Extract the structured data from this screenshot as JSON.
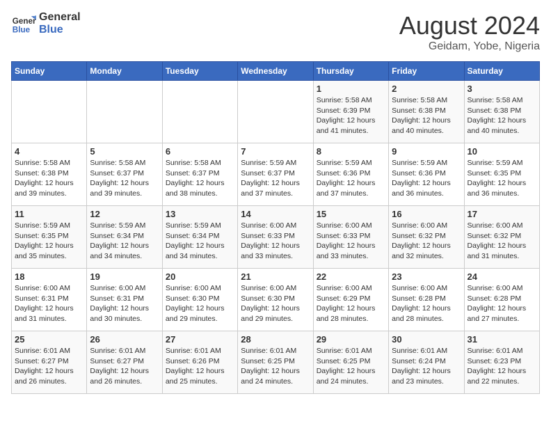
{
  "logo": {
    "general": "General",
    "blue": "Blue"
  },
  "title": "August 2024",
  "subtitle": "Geidam, Yobe, Nigeria",
  "days_of_week": [
    "Sunday",
    "Monday",
    "Tuesday",
    "Wednesday",
    "Thursday",
    "Friday",
    "Saturday"
  ],
  "weeks": [
    [
      {
        "day": "",
        "info": ""
      },
      {
        "day": "",
        "info": ""
      },
      {
        "day": "",
        "info": ""
      },
      {
        "day": "",
        "info": ""
      },
      {
        "day": "1",
        "info": "Sunrise: 5:58 AM\nSunset: 6:39 PM\nDaylight: 12 hours\nand 41 minutes."
      },
      {
        "day": "2",
        "info": "Sunrise: 5:58 AM\nSunset: 6:38 PM\nDaylight: 12 hours\nand 40 minutes."
      },
      {
        "day": "3",
        "info": "Sunrise: 5:58 AM\nSunset: 6:38 PM\nDaylight: 12 hours\nand 40 minutes."
      }
    ],
    [
      {
        "day": "4",
        "info": "Sunrise: 5:58 AM\nSunset: 6:38 PM\nDaylight: 12 hours\nand 39 minutes."
      },
      {
        "day": "5",
        "info": "Sunrise: 5:58 AM\nSunset: 6:37 PM\nDaylight: 12 hours\nand 39 minutes."
      },
      {
        "day": "6",
        "info": "Sunrise: 5:58 AM\nSunset: 6:37 PM\nDaylight: 12 hours\nand 38 minutes."
      },
      {
        "day": "7",
        "info": "Sunrise: 5:59 AM\nSunset: 6:37 PM\nDaylight: 12 hours\nand 37 minutes."
      },
      {
        "day": "8",
        "info": "Sunrise: 5:59 AM\nSunset: 6:36 PM\nDaylight: 12 hours\nand 37 minutes."
      },
      {
        "day": "9",
        "info": "Sunrise: 5:59 AM\nSunset: 6:36 PM\nDaylight: 12 hours\nand 36 minutes."
      },
      {
        "day": "10",
        "info": "Sunrise: 5:59 AM\nSunset: 6:35 PM\nDaylight: 12 hours\nand 36 minutes."
      }
    ],
    [
      {
        "day": "11",
        "info": "Sunrise: 5:59 AM\nSunset: 6:35 PM\nDaylight: 12 hours\nand 35 minutes."
      },
      {
        "day": "12",
        "info": "Sunrise: 5:59 AM\nSunset: 6:34 PM\nDaylight: 12 hours\nand 34 minutes."
      },
      {
        "day": "13",
        "info": "Sunrise: 5:59 AM\nSunset: 6:34 PM\nDaylight: 12 hours\nand 34 minutes."
      },
      {
        "day": "14",
        "info": "Sunrise: 6:00 AM\nSunset: 6:33 PM\nDaylight: 12 hours\nand 33 minutes."
      },
      {
        "day": "15",
        "info": "Sunrise: 6:00 AM\nSunset: 6:33 PM\nDaylight: 12 hours\nand 33 minutes."
      },
      {
        "day": "16",
        "info": "Sunrise: 6:00 AM\nSunset: 6:32 PM\nDaylight: 12 hours\nand 32 minutes."
      },
      {
        "day": "17",
        "info": "Sunrise: 6:00 AM\nSunset: 6:32 PM\nDaylight: 12 hours\nand 31 minutes."
      }
    ],
    [
      {
        "day": "18",
        "info": "Sunrise: 6:00 AM\nSunset: 6:31 PM\nDaylight: 12 hours\nand 31 minutes."
      },
      {
        "day": "19",
        "info": "Sunrise: 6:00 AM\nSunset: 6:31 PM\nDaylight: 12 hours\nand 30 minutes."
      },
      {
        "day": "20",
        "info": "Sunrise: 6:00 AM\nSunset: 6:30 PM\nDaylight: 12 hours\nand 29 minutes."
      },
      {
        "day": "21",
        "info": "Sunrise: 6:00 AM\nSunset: 6:30 PM\nDaylight: 12 hours\nand 29 minutes."
      },
      {
        "day": "22",
        "info": "Sunrise: 6:00 AM\nSunset: 6:29 PM\nDaylight: 12 hours\nand 28 minutes."
      },
      {
        "day": "23",
        "info": "Sunrise: 6:00 AM\nSunset: 6:28 PM\nDaylight: 12 hours\nand 28 minutes."
      },
      {
        "day": "24",
        "info": "Sunrise: 6:00 AM\nSunset: 6:28 PM\nDaylight: 12 hours\nand 27 minutes."
      }
    ],
    [
      {
        "day": "25",
        "info": "Sunrise: 6:01 AM\nSunset: 6:27 PM\nDaylight: 12 hours\nand 26 minutes."
      },
      {
        "day": "26",
        "info": "Sunrise: 6:01 AM\nSunset: 6:27 PM\nDaylight: 12 hours\nand 26 minutes."
      },
      {
        "day": "27",
        "info": "Sunrise: 6:01 AM\nSunset: 6:26 PM\nDaylight: 12 hours\nand 25 minutes."
      },
      {
        "day": "28",
        "info": "Sunrise: 6:01 AM\nSunset: 6:25 PM\nDaylight: 12 hours\nand 24 minutes."
      },
      {
        "day": "29",
        "info": "Sunrise: 6:01 AM\nSunset: 6:25 PM\nDaylight: 12 hours\nand 24 minutes."
      },
      {
        "day": "30",
        "info": "Sunrise: 6:01 AM\nSunset: 6:24 PM\nDaylight: 12 hours\nand 23 minutes."
      },
      {
        "day": "31",
        "info": "Sunrise: 6:01 AM\nSunset: 6:23 PM\nDaylight: 12 hours\nand 22 minutes."
      }
    ]
  ]
}
